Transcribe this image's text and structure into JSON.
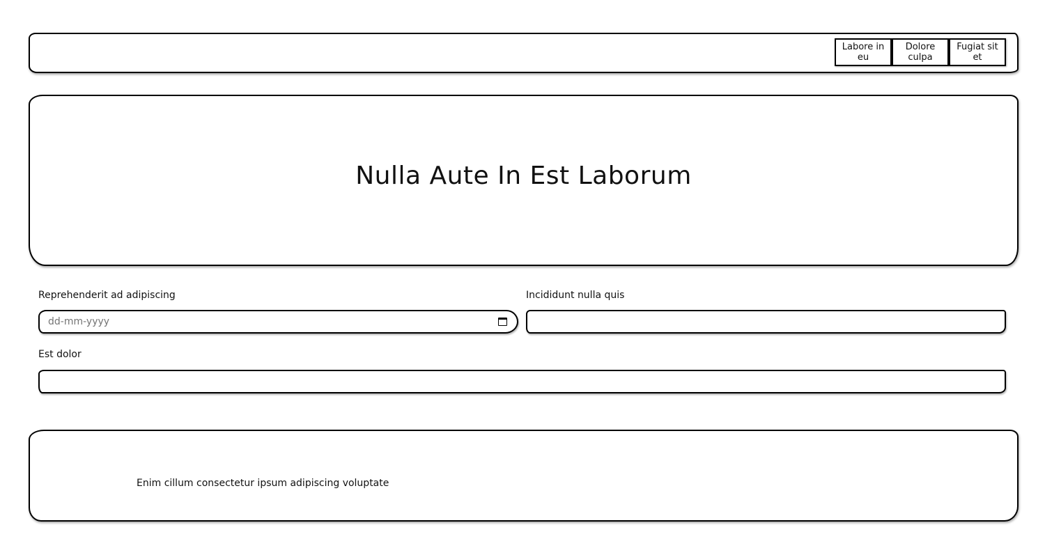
{
  "header": {
    "nav": [
      {
        "label": "Labore in eu"
      },
      {
        "label": "Dolore culpa"
      },
      {
        "label": "Fugiat sit et"
      }
    ]
  },
  "hero": {
    "title": "Nulla Aute In Est Laborum"
  },
  "form": {
    "date_label": "Reprehenderit ad adipiscing",
    "date_placeholder": "dd-mm-yyyy",
    "text1_label": "Incididunt nulla quis",
    "text1_value": "",
    "text2_label": "Est dolor",
    "text2_value": ""
  },
  "footer": {
    "text": "Enim cillum consectetur ipsum adipiscing voluptate"
  }
}
